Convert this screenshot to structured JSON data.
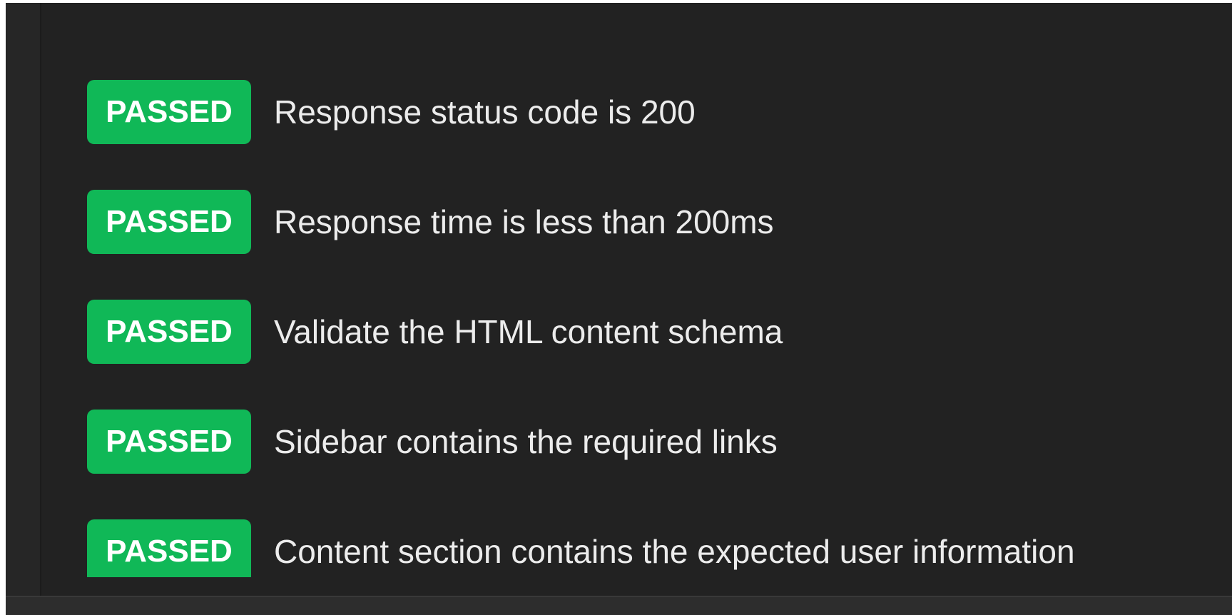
{
  "test_results": [
    {
      "status": "PASSED",
      "name": "Response status code is 200"
    },
    {
      "status": "PASSED",
      "name": "Response time is less than 200ms"
    },
    {
      "status": "PASSED",
      "name": "Validate the HTML content schema"
    },
    {
      "status": "PASSED",
      "name": "Sidebar contains the required links"
    },
    {
      "status": "PASSED",
      "name": "Content section contains the expected user information"
    }
  ],
  "colors": {
    "passed_badge": "#10b857",
    "panel_background": "#222222",
    "text": "#ececec"
  }
}
